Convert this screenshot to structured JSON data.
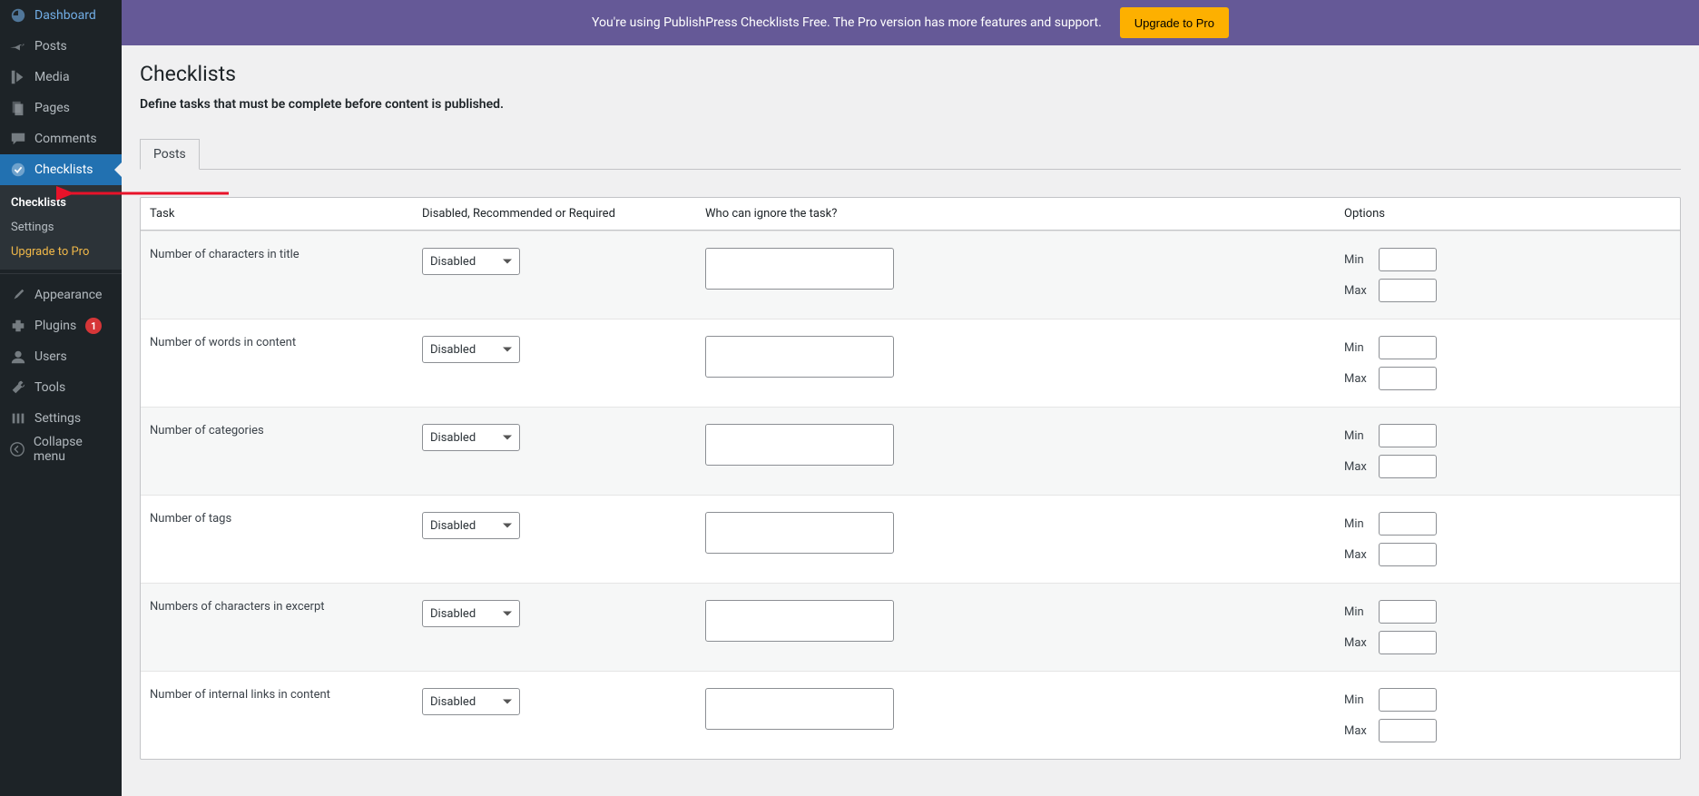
{
  "sidebar": {
    "items": [
      {
        "label": "Dashboard",
        "icon": "dashboard-icon",
        "glyph": "⌂"
      },
      {
        "label": "Posts",
        "icon": "pin-icon",
        "glyph": "✎"
      },
      {
        "label": "Media",
        "icon": "media-icon",
        "glyph": "❐"
      },
      {
        "label": "Pages",
        "icon": "pages-icon",
        "glyph": "▤"
      },
      {
        "label": "Comments",
        "icon": "comments-icon",
        "glyph": "💬"
      },
      {
        "label": "Checklists",
        "icon": "check-icon",
        "glyph": "✔"
      }
    ],
    "submenu": [
      {
        "label": "Checklists"
      },
      {
        "label": "Settings"
      },
      {
        "label": "Upgrade to Pro"
      }
    ],
    "items2": [
      {
        "label": "Appearance",
        "icon": "brush-icon",
        "glyph": "✦"
      },
      {
        "label": "Plugins",
        "icon": "plugin-icon",
        "glyph": "✱",
        "badge": "1"
      },
      {
        "label": "Users",
        "icon": "users-icon",
        "glyph": "👤"
      },
      {
        "label": "Tools",
        "icon": "tools-icon",
        "glyph": "🔧"
      },
      {
        "label": "Settings",
        "icon": "settings-icon",
        "glyph": "⚙"
      }
    ],
    "collapse_label": "Collapse menu"
  },
  "banner": {
    "text": "You're using PublishPress Checklists Free. The Pro version has more features and support.",
    "button": "Upgrade to Pro"
  },
  "page": {
    "title": "Checklists",
    "subtitle": "Define tasks that must be complete before content is published."
  },
  "tabs": [
    {
      "label": "Posts"
    }
  ],
  "table": {
    "headers": {
      "task": "Task",
      "rule": "Disabled, Recommended or Required",
      "ignore": "Who can ignore the task?",
      "options": "Options"
    },
    "option_labels": {
      "min": "Min",
      "max": "Max"
    },
    "rows": [
      {
        "task": "Number of characters in title",
        "rule": "Disabled"
      },
      {
        "task": "Number of words in content",
        "rule": "Disabled"
      },
      {
        "task": "Number of categories",
        "rule": "Disabled"
      },
      {
        "task": "Number of tags",
        "rule": "Disabled"
      },
      {
        "task": "Numbers of characters in excerpt",
        "rule": "Disabled"
      },
      {
        "task": "Number of internal links in content",
        "rule": "Disabled"
      }
    ]
  }
}
